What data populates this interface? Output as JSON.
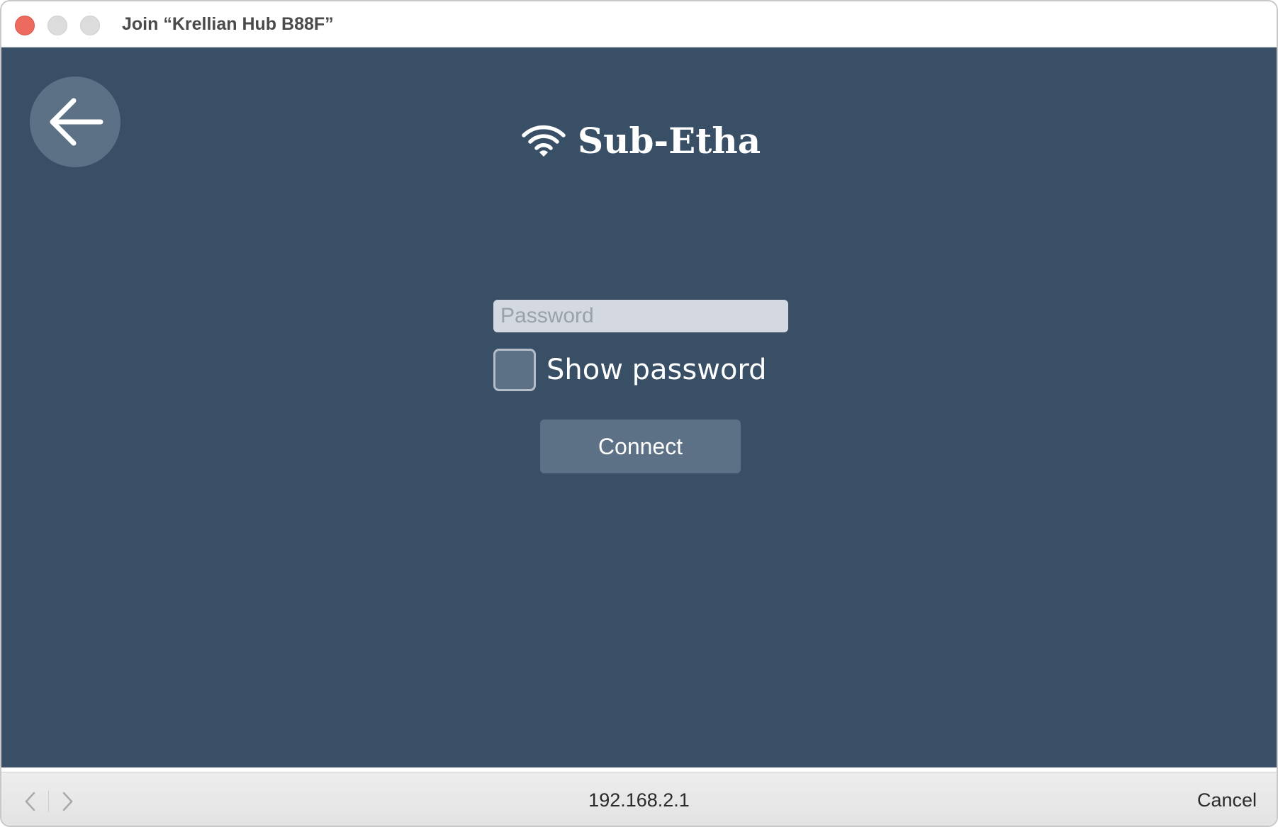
{
  "window": {
    "title": "Join “Krellian Hub B88F”"
  },
  "header": {
    "back_icon": "arrow-left-icon",
    "brand_icon": "wifi-icon",
    "brand_name": "Sub-Etha"
  },
  "form": {
    "password_placeholder": "Password",
    "password_value": "",
    "show_password_label": "Show password",
    "show_password_checked": false,
    "connect_label": "Connect"
  },
  "bottom_bar": {
    "back_icon": "chevron-left-icon",
    "forward_icon": "chevron-right-icon",
    "address": "192.168.2.1",
    "cancel_label": "Cancel"
  },
  "colors": {
    "content_background": "#384f66",
    "button_background": "#5c7186",
    "input_background": "#d4d9e1",
    "close_button": "#ed6a5e"
  }
}
